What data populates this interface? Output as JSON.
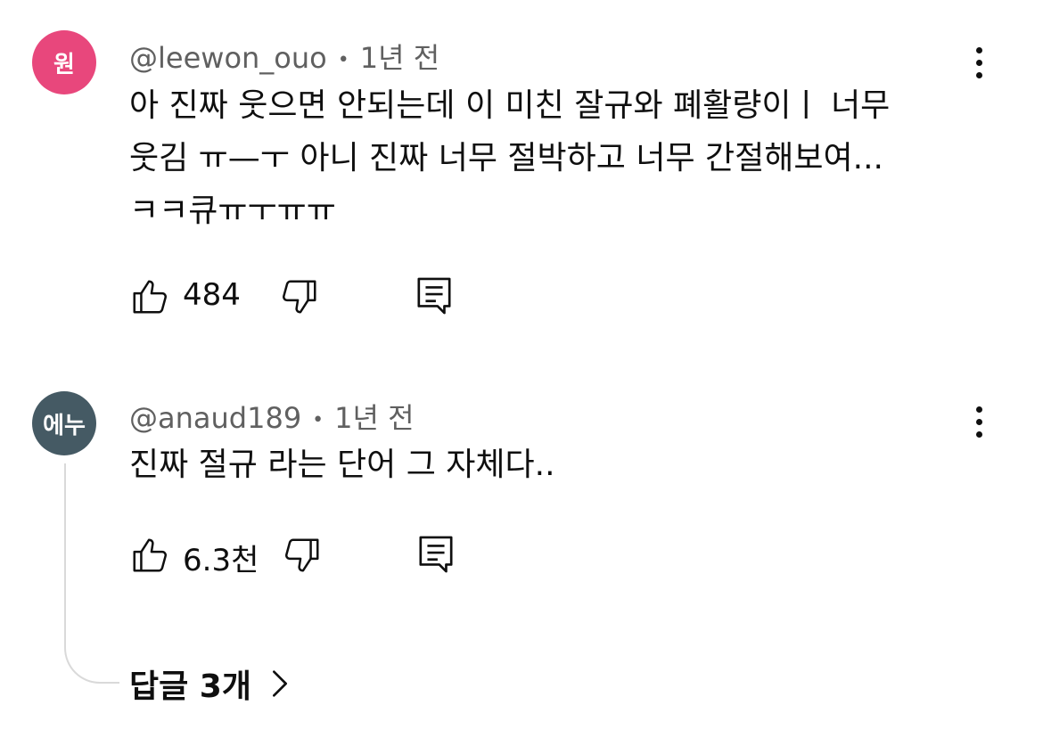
{
  "comments": [
    {
      "avatar_text": "원",
      "avatar_color": "#e8477c",
      "handle": "@leewon_ouo",
      "separator": "•",
      "time": "1년 전",
      "lines": [
        "아 진짜 웃으면 안되는데 이 미친 잘규와 폐활량이ㅣ 너무",
        "웃김 ㅠ—ㅜ 아니 진짜 너무 절박하고 너무 간절해보여...",
        "ㅋㅋ큐ㅠㅜㅠㅠ"
      ],
      "likes": "484"
    },
    {
      "avatar_text": "에누",
      "avatar_color": "#455a64",
      "handle": "@anaud189",
      "separator": "•",
      "time": "1년 전",
      "lines": [
        "진짜 절규 라는 단어 그 자체다.."
      ],
      "likes": "6.3천"
    }
  ],
  "replies_label": "답글 3개",
  "icons": [
    "like-icon",
    "dislike-icon",
    "reply-icon",
    "more-vert-icon",
    "chevron-right-icon"
  ]
}
